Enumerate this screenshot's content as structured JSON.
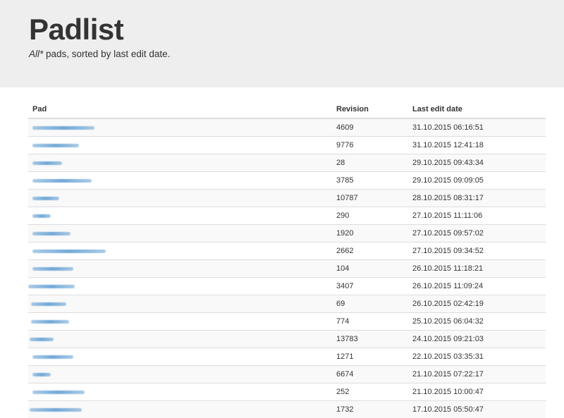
{
  "header": {
    "title": "Padlist",
    "subtitle_em": "All*",
    "subtitle_rest": " pads, sorted by last edit date."
  },
  "table": {
    "columns": [
      "Pad",
      "Revision",
      "Last edit date"
    ],
    "rows": [
      {
        "revision": "4609",
        "date": "31.10.2015 06:16:51"
      },
      {
        "revision": "9776",
        "date": "31.10.2015 12:41:18"
      },
      {
        "revision": "28",
        "date": "29.10.2015 09:43:34"
      },
      {
        "revision": "3785",
        "date": "29.10.2015 09:09:05"
      },
      {
        "revision": "10787",
        "date": "28.10.2015 08:31:17"
      },
      {
        "revision": "290",
        "date": "27.10.2015 11:11:06"
      },
      {
        "revision": "1920",
        "date": "27.10.2015 09:57:02"
      },
      {
        "revision": "2662",
        "date": "27.10.2015 09:34:52"
      },
      {
        "revision": "104",
        "date": "26.10.2015 11:18:21"
      },
      {
        "revision": "3407",
        "date": "26.10.2015 11:09:24"
      },
      {
        "revision": "69",
        "date": "26.10.2015 02:42:19"
      },
      {
        "revision": "774",
        "date": "25.10.2015 06:04:32"
      },
      {
        "revision": "13783",
        "date": "24.10.2015 09:21:03"
      },
      {
        "revision": "1271",
        "date": "22.10.2015 03:35:31"
      },
      {
        "revision": "6674",
        "date": "21.10.2015 07:22:17"
      },
      {
        "revision": "252",
        "date": "21.10.2015 10:00:47"
      },
      {
        "revision": "1732",
        "date": "17.10.2015 05:50:47"
      }
    ]
  }
}
